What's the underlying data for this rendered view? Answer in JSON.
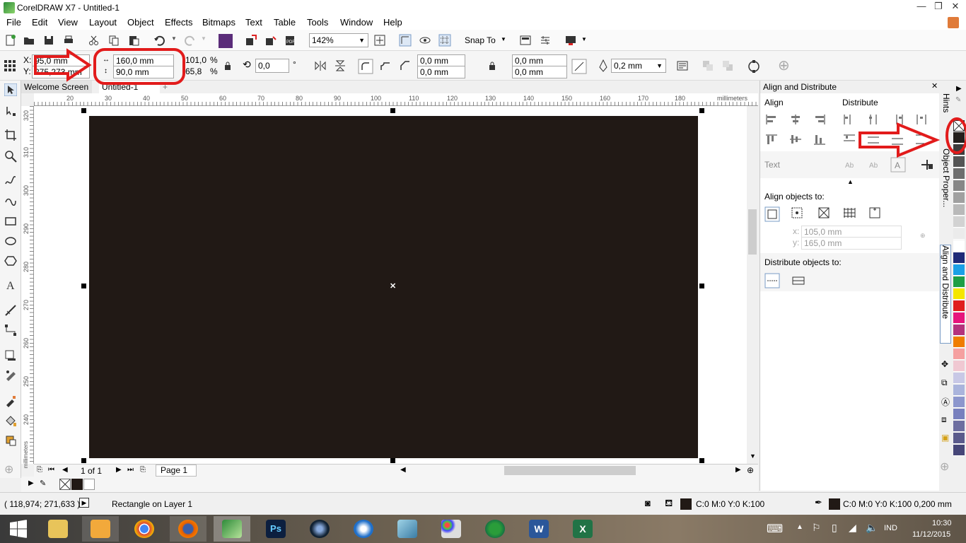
{
  "window": {
    "title": "CorelDRAW X7 - Untitled-1",
    "minimize": "—",
    "restore": "❐",
    "close": "✕"
  },
  "menu": [
    "File",
    "Edit",
    "View",
    "Layout",
    "Object",
    "Effects",
    "Bitmaps",
    "Text",
    "Table",
    "Tools",
    "Window",
    "Help"
  ],
  "stdbar": {
    "zoom": "142%",
    "snap_to": "Snap To"
  },
  "propbar": {
    "x_label": "X:",
    "x_value": "95,0 mm",
    "y_label": "Y:",
    "y_value": "275,273 mm",
    "width": "160,0 mm",
    "height": "90,0 mm",
    "scale_w": "101,0",
    "scale_h": "65,8",
    "pct1": "%",
    "pct2": "%",
    "rotation": "0,0",
    "deg": "°",
    "corner1": "0,0 mm",
    "corner2": "0,0 mm",
    "corner3": "0,0 mm",
    "corner4": "0,0 mm",
    "outline": "0,2 mm"
  },
  "tabs": {
    "welcome": "Welcome Screen",
    "doc": "Untitled-1",
    "add": "+"
  },
  "hruler": {
    "unit": "millimeters",
    "ticks": [
      "20",
      "30",
      "40",
      "50",
      "60",
      "70",
      "80",
      "90",
      "100",
      "110",
      "120",
      "130",
      "140",
      "150",
      "160",
      "170",
      "180"
    ]
  },
  "vruler": {
    "unit": "millimeters",
    "ticks": [
      "320",
      "310",
      "300",
      "290",
      "280",
      "270",
      "260",
      "250",
      "240"
    ]
  },
  "pagenav": {
    "counter": "1 of 1",
    "page_tab": "Page 1"
  },
  "docker": {
    "title": "Align and Distribute",
    "align": "Align",
    "distribute": "Distribute",
    "text": "Text",
    "align_to": "Align objects to:",
    "x_label": "x:",
    "x_value": "105,0 mm",
    "y_label": "y:",
    "y_value": "165,0 mm",
    "distribute_to": "Distribute objects to:"
  },
  "sidetabs": {
    "hints": "Hints",
    "props": "Object Proper...",
    "align": "Align and Distribute"
  },
  "palette": [
    "#ffffff",
    "#231f1c",
    "#3c3c3c",
    "#555555",
    "#6e6e6e",
    "#878787",
    "#a0a0a0",
    "#b9b9b9",
    "#d2d2d2",
    "#ebebeb",
    "#ffffff",
    "#1e2a78",
    "#1aa0e6",
    "#1e9e46",
    "#f5e600",
    "#e01e1e",
    "#e6147d",
    "#b4327d",
    "#ef7d00",
    "#f5a0a0",
    "#f0c8d2",
    "#c8c8e6",
    "#aab4dc",
    "#8c96cd",
    "#7880be",
    "#6e6ea0",
    "#5a5a8c",
    "#464678"
  ],
  "status": {
    "coords": "( 118,974; 271,633 )",
    "info": "Rectangle on Layer 1",
    "fill": "C:0 M:0 Y:0 K:100",
    "outline": "C:0 M:0 Y:0 K:100  0,200 mm"
  },
  "taskbar": {
    "time": "10:30",
    "date": "11/12/2015",
    "lang": "IND"
  },
  "colors": {
    "rect_fill": "#211915",
    "annotation": "#e21b1b"
  }
}
